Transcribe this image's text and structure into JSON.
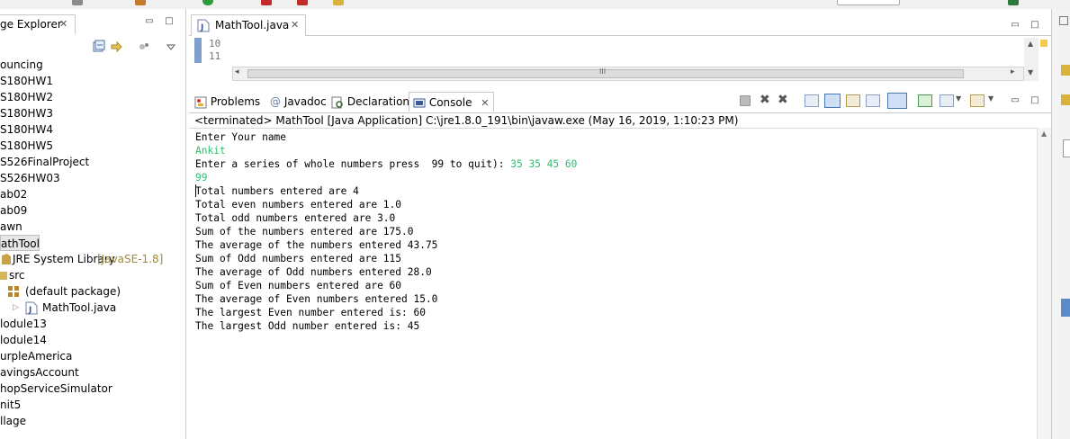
{
  "package_explorer": {
    "tab_label": "ge Explorer",
    "close_glyph": "✕",
    "items": [
      {
        "label": "ouncing"
      },
      {
        "label": "S180HW1"
      },
      {
        "label": "S180HW2"
      },
      {
        "label": "S180HW3"
      },
      {
        "label": "S180HW4"
      },
      {
        "label": "S180HW5"
      },
      {
        "label": "S526FinalProject"
      },
      {
        "label": "S526HW03"
      },
      {
        "label": "ab02"
      },
      {
        "label": "ab09"
      },
      {
        "label": "awn"
      },
      {
        "label": "athTool"
      },
      {
        "label": "JRE System Library",
        "decoration": "[JavaSE-1.8]"
      },
      {
        "label": "src"
      },
      {
        "label": "(default package)"
      },
      {
        "label": "MathTool.java"
      },
      {
        "label": "lodule13"
      },
      {
        "label": "lodule14"
      },
      {
        "label": "urpleAmerica"
      },
      {
        "label": "avingsAccount"
      },
      {
        "label": "hopServiceSimulator"
      },
      {
        "label": "nit5"
      },
      {
        "label": "llage"
      }
    ]
  },
  "editor": {
    "tab_label": "MathTool.java",
    "close_glyph": "✕",
    "line_numbers": [
      "10",
      "11"
    ],
    "scroll_thumb_glyph": "III"
  },
  "console": {
    "tabs": [
      {
        "label": "Problems"
      },
      {
        "label": "Javadoc"
      },
      {
        "label": "Declaration"
      },
      {
        "label": "Console"
      }
    ],
    "status": "<terminated> MathTool [Java Application] C:\\jre1.8.0_191\\bin\\javaw.exe (May 16, 2019, 1:10:23 PM)",
    "output": [
      {
        "text": "Enter Your name",
        "input": ""
      },
      {
        "text": "",
        "input": "Ankit"
      },
      {
        "text": "Enter a series of whole numbers press  99 to quit): ",
        "input": "35 35 45 60"
      },
      {
        "text": "",
        "input": "99"
      },
      {
        "text": "Total numbers entered are 4",
        "input": ""
      },
      {
        "text": "Total even numbers entered are 1.0",
        "input": ""
      },
      {
        "text": "Total odd numbers entered are 3.0",
        "input": ""
      },
      {
        "text": "Sum of the numbers entered are 175.0",
        "input": ""
      },
      {
        "text": "The average of the numbers entered 43.75",
        "input": ""
      },
      {
        "text": "Sum of Odd numbers entered are 115",
        "input": ""
      },
      {
        "text": "The average of Odd numbers entered 28.0",
        "input": ""
      },
      {
        "text": "Sum of Even numbers entered are 60",
        "input": ""
      },
      {
        "text": "The average of Even numbers entered 15.0",
        "input": ""
      },
      {
        "text": "The largest Even number entered is: 60",
        "input": ""
      },
      {
        "text": "The largest Odd number entered is: 45",
        "input": ""
      }
    ]
  },
  "colors": {
    "user_input": "#2fbf70",
    "decoration": "#a08a3c"
  }
}
